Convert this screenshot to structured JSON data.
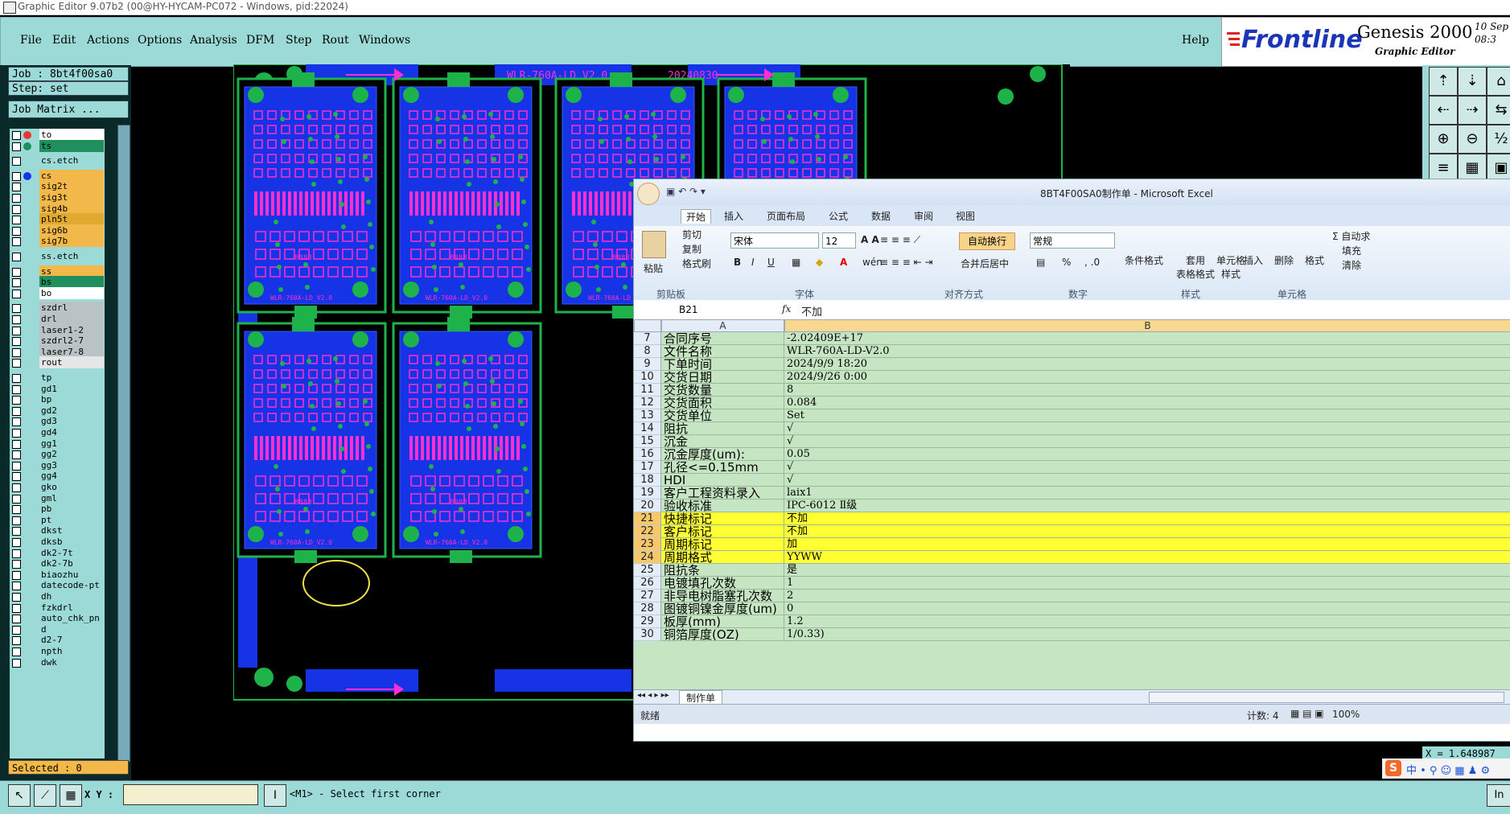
{
  "genesis": {
    "window_title": "Graphic Editor 9.07b2 (00@HY-HYCAM-PC072 - Windows, pid:22024)",
    "menu": [
      "File",
      "Edit",
      "Actions",
      "Options",
      "Analysis",
      "DFM",
      "Step",
      "Rout",
      "Windows"
    ],
    "help": "Help",
    "logo_text": "Frontline",
    "product": "Genesis 2000",
    "product_sub": "Graphic Editor",
    "date_partial": "10 Sep",
    "time_partial": "08:3",
    "job": "Job : 8bt4f00sa0",
    "step": "Step: set",
    "job_matrix": "Job Matrix ...",
    "selected": "Selected : 0",
    "xy_label": "X Y :",
    "prompt": "<M1> - Select first corner",
    "x_readout": "X = 1.648987",
    "right_edge_label": "In",
    "colors": {
      "panel": "#9bdad6",
      "highlight": "#f3b84a",
      "layer_green": "#2e8f5d"
    }
  },
  "layers": [
    {
      "name": "to",
      "bg": "#ffffff",
      "dot": "#e33"
    },
    {
      "name": "ts",
      "bg": "#1f8f5e",
      "dot": "#1f8f5e"
    },
    {
      "name": "cs.etch",
      "bg": "#9bdad6",
      "dot": ""
    },
    {
      "name": "cs",
      "bg": "#f3b84a",
      "dot": "#1733e6"
    },
    {
      "name": "sig2t",
      "bg": "#f3b84a",
      "dot": ""
    },
    {
      "name": "sig3t",
      "bg": "#f3b84a",
      "dot": ""
    },
    {
      "name": "sig4b",
      "bg": "#f3b84a",
      "dot": ""
    },
    {
      "name": "pln5t",
      "bg": "#e0a930",
      "dot": ""
    },
    {
      "name": "sig6b",
      "bg": "#f3b84a",
      "dot": ""
    },
    {
      "name": "sig7b",
      "bg": "#f3b84a",
      "dot": ""
    },
    {
      "name": "ss.etch",
      "bg": "#9bdad6",
      "dot": ""
    },
    {
      "name": "ss",
      "bg": "#f3b84a",
      "dot": ""
    },
    {
      "name": "bs",
      "bg": "#1f8f5e",
      "dot": ""
    },
    {
      "name": "bo",
      "bg": "#ffffff",
      "dot": ""
    },
    {
      "name": "szdrl",
      "bg": "#b9c3c6",
      "dot": ""
    },
    {
      "name": "drl",
      "bg": "#b9c3c6",
      "dot": ""
    },
    {
      "name": "laser1-2",
      "bg": "#b9c3c6",
      "dot": ""
    },
    {
      "name": "szdrl2-7",
      "bg": "#b9c3c6",
      "dot": ""
    },
    {
      "name": "laser7-8",
      "bg": "#b9c3c6",
      "dot": ""
    },
    {
      "name": "rout",
      "bg": "#e6e6e6",
      "dot": ""
    },
    {
      "name": "tp",
      "bg": "#9bdad6",
      "dot": ""
    },
    {
      "name": "gd1",
      "bg": "#9bdad6",
      "dot": ""
    },
    {
      "name": "bp",
      "bg": "#9bdad6",
      "dot": ""
    },
    {
      "name": "gd2",
      "bg": "#9bdad6",
      "dot": ""
    },
    {
      "name": "gd3",
      "bg": "#9bdad6",
      "dot": ""
    },
    {
      "name": "gd4",
      "bg": "#9bdad6",
      "dot": ""
    },
    {
      "name": "gg1",
      "bg": "#9bdad6",
      "dot": ""
    },
    {
      "name": "gg2",
      "bg": "#9bdad6",
      "dot": ""
    },
    {
      "name": "gg3",
      "bg": "#9bdad6",
      "dot": ""
    },
    {
      "name": "gg4",
      "bg": "#9bdad6",
      "dot": ""
    },
    {
      "name": "gko",
      "bg": "#9bdad6",
      "dot": ""
    },
    {
      "name": "gml",
      "bg": "#9bdad6",
      "dot": ""
    },
    {
      "name": "pb",
      "bg": "#9bdad6",
      "dot": ""
    },
    {
      "name": "pt",
      "bg": "#9bdad6",
      "dot": ""
    },
    {
      "name": "dkst",
      "bg": "#9bdad6",
      "dot": ""
    },
    {
      "name": "dksb",
      "bg": "#9bdad6",
      "dot": ""
    },
    {
      "name": "dk2-7t",
      "bg": "#9bdad6",
      "dot": ""
    },
    {
      "name": "dk2-7b",
      "bg": "#9bdad6",
      "dot": ""
    },
    {
      "name": "biaozhu",
      "bg": "#9bdad6",
      "dot": ""
    },
    {
      "name": "datecode-pt",
      "bg": "#9bdad6",
      "dot": ""
    },
    {
      "name": "dh",
      "bg": "#9bdad6",
      "dot": ""
    },
    {
      "name": "fzkdrl",
      "bg": "#9bdad6",
      "dot": ""
    },
    {
      "name": "auto_chk_pn",
      "bg": "#9bdad6",
      "dot": ""
    },
    {
      "name": "d",
      "bg": "#9bdad6",
      "dot": ""
    },
    {
      "name": "d2-7",
      "bg": "#9bdad6",
      "dot": ""
    },
    {
      "name": "npth",
      "bg": "#9bdad6",
      "dot": ""
    },
    {
      "name": "dwk",
      "bg": "#9bdad6",
      "dot": ""
    }
  ],
  "pcb": {
    "panel_label": "WLR-760A-LD_V2.0",
    "date_code": "20240830",
    "board_text": "8888",
    "board_label": "WLR-760A-LD_V2.0"
  },
  "excel": {
    "title": "8BT4F00SA0制作单 - Microsoft Excel",
    "tabs": [
      "开始",
      "插入",
      "页面布局",
      "公式",
      "数据",
      "审阅",
      "视图"
    ],
    "clipboard": {
      "paste": "粘贴",
      "cut": "剪切",
      "copy": "复制",
      "format_painter": "格式刷",
      "group": "剪贴板"
    },
    "font": {
      "name": "宋体",
      "size": "12",
      "group": "字体",
      "bold": "B",
      "italic": "I",
      "underline": "U",
      "wen": "wén"
    },
    "alignment": {
      "wrap": "自动换行",
      "merge": "合并后居中",
      "group": "对齐方式"
    },
    "number": {
      "format": "常规",
      "group": "数字",
      "percent": "%"
    },
    "styles": {
      "cond": "条件格式",
      "table": "套用\n表格格式",
      "cell": "单元格\n样式",
      "group": "样式"
    },
    "cells": {
      "insert": "插入",
      "delete": "删除",
      "format": "格式",
      "group": "单元格"
    },
    "editing": {
      "autosum": "Σ 自动求",
      "fill": "填充",
      "clear": "清除"
    },
    "name_box": "B21",
    "fx": "fx",
    "formula_value": "不加",
    "col_a": "A",
    "col_b": "B",
    "rows": [
      {
        "n": "7",
        "a": "合同序号",
        "b": "-2.02409E+17",
        "hl": false
      },
      {
        "n": "8",
        "a": "文件名称",
        "b": "WLR-760A-LD-V2.0",
        "hl": false
      },
      {
        "n": "9",
        "a": "下单时间",
        "b": "2024/9/9 18:20",
        "hl": false
      },
      {
        "n": "10",
        "a": "交货日期",
        "b": "2024/9/26 0:00",
        "hl": false
      },
      {
        "n": "11",
        "a": "交货数量",
        "b": "8",
        "hl": false
      },
      {
        "n": "12",
        "a": "交货面积",
        "b": "0.084",
        "hl": false
      },
      {
        "n": "13",
        "a": "交货单位",
        "b": "Set",
        "hl": false
      },
      {
        "n": "14",
        "a": "阻抗",
        "b": "√",
        "hl": false
      },
      {
        "n": "15",
        "a": "沉金",
        "b": "√",
        "hl": false
      },
      {
        "n": "16",
        "a": "沉金厚度(um):",
        "b": "0.05",
        "hl": false
      },
      {
        "n": "17",
        "a": "孔径<=0.15mm",
        "b": "√",
        "hl": false
      },
      {
        "n": "18",
        "a": "HDI",
        "b": "√",
        "hl": false
      },
      {
        "n": "19",
        "a": "客户工程资料录入",
        "b": "laix1",
        "hl": false
      },
      {
        "n": "20",
        "a": "验收标准",
        "b": "IPC-6012 Ⅱ级",
        "hl": false
      },
      {
        "n": "21",
        "a": "快捷标记",
        "b": "不加",
        "hl": true
      },
      {
        "n": "22",
        "a": "客户标记",
        "b": "不加",
        "hl": true
      },
      {
        "n": "23",
        "a": "周期标记",
        "b": "加",
        "hl": true
      },
      {
        "n": "24",
        "a": "周期格式",
        "b": "YYWW",
        "hl": true
      },
      {
        "n": "25",
        "a": "阻抗条",
        "b": "是",
        "hl": false
      },
      {
        "n": "26",
        "a": "电镀填孔次数",
        "b": "1",
        "hl": false
      },
      {
        "n": "27",
        "a": "非导电树脂塞孔次数",
        "b": "2",
        "hl": false
      },
      {
        "n": "28",
        "a": "图镀铜镍金厚度(um)",
        "b": "0",
        "hl": false
      },
      {
        "n": "29",
        "a": "板厚(mm)",
        "b": "1.2",
        "hl": false
      },
      {
        "n": "30",
        "a": "铜箔厚度(OZ)",
        "b": "1/0.33)",
        "hl": false
      }
    ],
    "sheet_tab": "制作单",
    "status_ready": "就绪",
    "status_count": "计数: 4",
    "zoom": "100%"
  }
}
